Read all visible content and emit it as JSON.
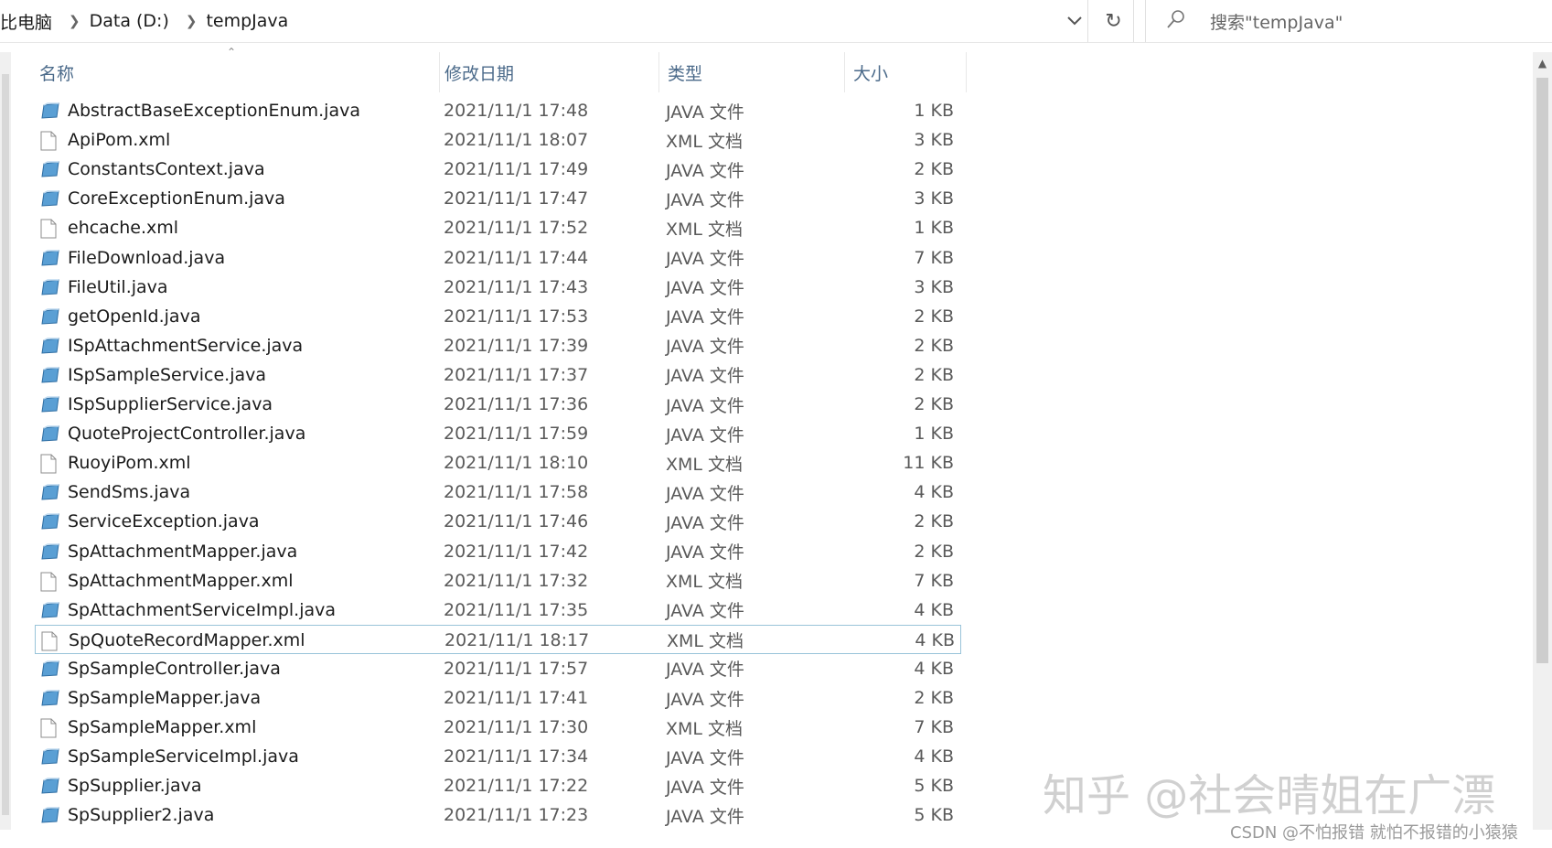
{
  "address_bar": {
    "crumbs": [
      "比电脑",
      "Data (D:)",
      "tempJava"
    ]
  },
  "search": {
    "placeholder": "搜索\"tempJava\""
  },
  "columns": {
    "name": "名称",
    "date": "修改日期",
    "type": "类型",
    "size": "大小"
  },
  "files": [
    {
      "name": "AbstractBaseExceptionEnum.java",
      "date": "2021/11/1 17:48",
      "type": "JAVA 文件",
      "size": "1 KB",
      "kind": "java"
    },
    {
      "name": "ApiPom.xml",
      "date": "2021/11/1 18:07",
      "type": "XML 文档",
      "size": "3 KB",
      "kind": "xml"
    },
    {
      "name": "ConstantsContext.java",
      "date": "2021/11/1 17:49",
      "type": "JAVA 文件",
      "size": "2 KB",
      "kind": "java"
    },
    {
      "name": "CoreExceptionEnum.java",
      "date": "2021/11/1 17:47",
      "type": "JAVA 文件",
      "size": "3 KB",
      "kind": "java"
    },
    {
      "name": "ehcache.xml",
      "date": "2021/11/1 17:52",
      "type": "XML 文档",
      "size": "1 KB",
      "kind": "xml"
    },
    {
      "name": "FileDownload.java",
      "date": "2021/11/1 17:44",
      "type": "JAVA 文件",
      "size": "7 KB",
      "kind": "java"
    },
    {
      "name": "FileUtil.java",
      "date": "2021/11/1 17:43",
      "type": "JAVA 文件",
      "size": "3 KB",
      "kind": "java"
    },
    {
      "name": "getOpenId.java",
      "date": "2021/11/1 17:53",
      "type": "JAVA 文件",
      "size": "2 KB",
      "kind": "java"
    },
    {
      "name": "ISpAttachmentService.java",
      "date": "2021/11/1 17:39",
      "type": "JAVA 文件",
      "size": "2 KB",
      "kind": "java"
    },
    {
      "name": "ISpSampleService.java",
      "date": "2021/11/1 17:37",
      "type": "JAVA 文件",
      "size": "2 KB",
      "kind": "java"
    },
    {
      "name": "ISpSupplierService.java",
      "date": "2021/11/1 17:36",
      "type": "JAVA 文件",
      "size": "2 KB",
      "kind": "java"
    },
    {
      "name": "QuoteProjectController.java",
      "date": "2021/11/1 17:59",
      "type": "JAVA 文件",
      "size": "1 KB",
      "kind": "java"
    },
    {
      "name": "RuoyiPom.xml",
      "date": "2021/11/1 18:10",
      "type": "XML 文档",
      "size": "11 KB",
      "kind": "xml"
    },
    {
      "name": "SendSms.java",
      "date": "2021/11/1 17:58",
      "type": "JAVA 文件",
      "size": "4 KB",
      "kind": "java"
    },
    {
      "name": "ServiceException.java",
      "date": "2021/11/1 17:46",
      "type": "JAVA 文件",
      "size": "2 KB",
      "kind": "java"
    },
    {
      "name": "SpAttachmentMapper.java",
      "date": "2021/11/1 17:42",
      "type": "JAVA 文件",
      "size": "2 KB",
      "kind": "java"
    },
    {
      "name": "SpAttachmentMapper.xml",
      "date": "2021/11/1 17:32",
      "type": "XML 文档",
      "size": "7 KB",
      "kind": "xml"
    },
    {
      "name": "SpAttachmentServiceImpl.java",
      "date": "2021/11/1 17:35",
      "type": "JAVA 文件",
      "size": "4 KB",
      "kind": "java"
    },
    {
      "name": "SpQuoteRecordMapper.xml",
      "date": "2021/11/1 18:17",
      "type": "XML 文档",
      "size": "4 KB",
      "kind": "xml",
      "selected": true
    },
    {
      "name": "SpSampleController.java",
      "date": "2021/11/1 17:57",
      "type": "JAVA 文件",
      "size": "4 KB",
      "kind": "java"
    },
    {
      "name": "SpSampleMapper.java",
      "date": "2021/11/1 17:41",
      "type": "JAVA 文件",
      "size": "2 KB",
      "kind": "java"
    },
    {
      "name": "SpSampleMapper.xml",
      "date": "2021/11/1 17:30",
      "type": "XML 文档",
      "size": "7 KB",
      "kind": "xml"
    },
    {
      "name": "SpSampleServiceImpl.java",
      "date": "2021/11/1 17:34",
      "type": "JAVA 文件",
      "size": "4 KB",
      "kind": "java"
    },
    {
      "name": "SpSupplier.java",
      "date": "2021/11/1 17:22",
      "type": "JAVA 文件",
      "size": "5 KB",
      "kind": "java"
    },
    {
      "name": "SpSupplier2.java",
      "date": "2021/11/1 17:23",
      "type": "JAVA 文件",
      "size": "5 KB",
      "kind": "java"
    }
  ],
  "watermarks": {
    "zhihu": "知乎 @社会晴姐在广漂",
    "csdn": "CSDN @不怕报错 就怕不报错的小猿猿"
  },
  "colors": {
    "header_text": "#4b6a8a",
    "selection_border": "#99c4d9",
    "java_icon": "#5a9fd4"
  }
}
